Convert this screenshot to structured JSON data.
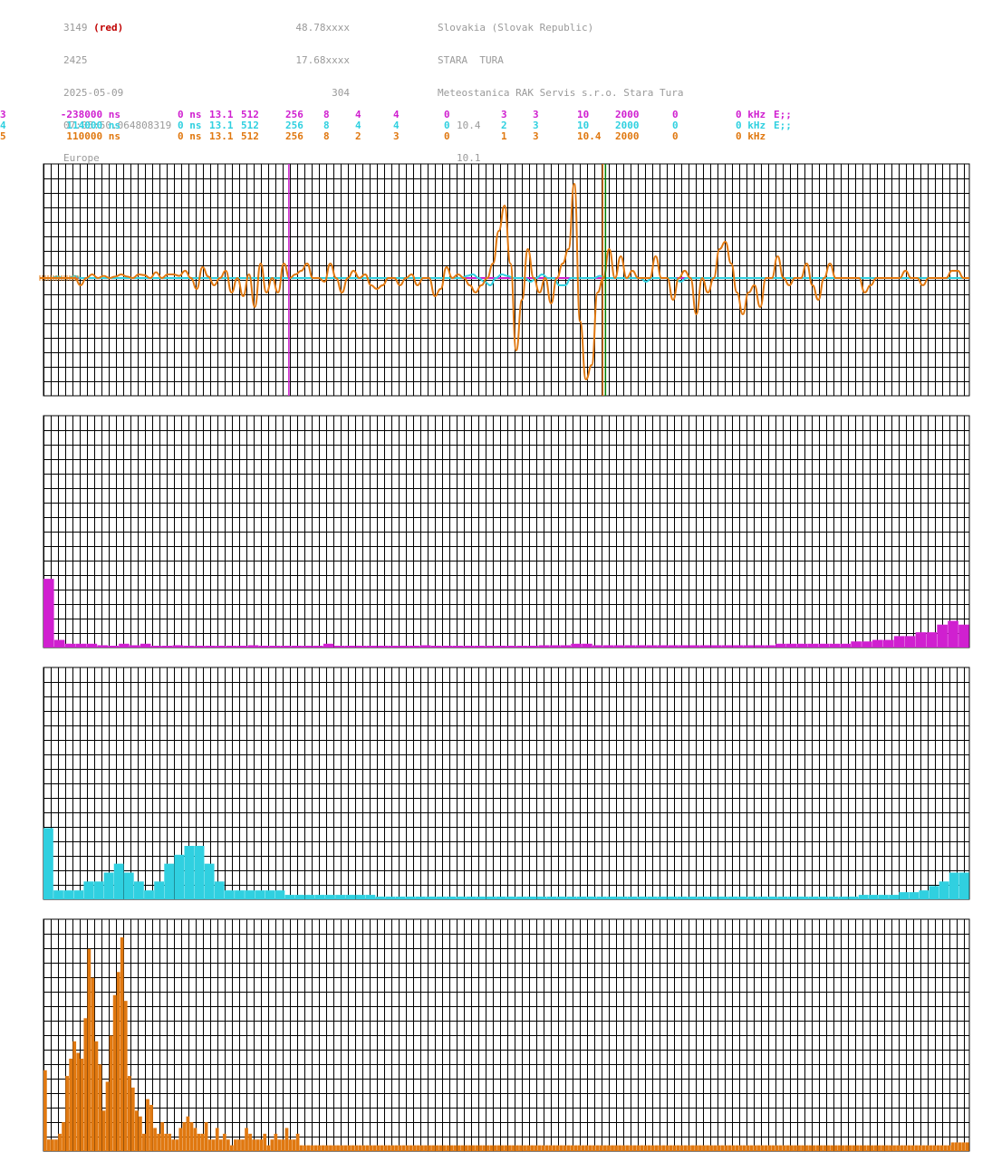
{
  "header": {
    "col1": [
      "3149",
      "2425",
      "2025-05-09",
      "07:05:50.064808319",
      "Europe"
    ],
    "col1_red": "(red)",
    "col2": [
      "48.78xxxx",
      "17.68xxxx",
      "304"
    ],
    "col3": [
      "Slovakia (Slovak Republic)",
      "STARA  TURA",
      "Meteostanica RAK Servis s.r.o. Stara Tura",
      "10.4",
      "10.1"
    ]
  },
  "channels": [
    {
      "id": "3",
      "color": "#d020d0",
      "cols": [
        "-238000 ns",
        "0 ns",
        "13.1",
        "512",
        "256",
        "8",
        "4",
        "4",
        "0",
        "3",
        "3",
        "10",
        "2000",
        "0",
        "0 kHz",
        "E;;"
      ]
    },
    {
      "id": "4",
      "color": "#30d0e0",
      "cols": [
        "114000 ns",
        "0 ns",
        "13.1",
        "512",
        "256",
        "8",
        "4",
        "4",
        "0",
        "2",
        "3",
        "10",
        "2000",
        "0",
        "0 kHz",
        "E;;"
      ]
    },
    {
      "id": "5",
      "color": "#e07810",
      "cols": [
        "110000 ns",
        "0 ns",
        "13.1",
        "512",
        "256",
        "8",
        "2",
        "3",
        "0",
        "1",
        "3",
        "10.4",
        "2000",
        "0",
        "0 kHz",
        ""
      ]
    }
  ],
  "colors": {
    "grid": "#000000",
    "magenta": "#d020d0",
    "cyan": "#30d0e0",
    "orange": "#e07810",
    "green": "#008000"
  },
  "chart_data": [
    {
      "type": "line",
      "series": [
        {
          "color": "#e07810",
          "values": [
            0,
            0,
            0,
            0,
            0,
            0,
            0,
            -1,
            0,
            0.5,
            0,
            0.3,
            0,
            0.2,
            0.5,
            0.2,
            0,
            0.5,
            0.4,
            0,
            0.8,
            0,
            0.5,
            0.5,
            0.3,
            1,
            0,
            -1.5,
            1.5,
            0.2,
            -1,
            0,
            1,
            -2,
            0,
            -2.5,
            0.5,
            -4,
            2,
            -2,
            0,
            -2,
            2,
            0,
            0.5,
            1,
            2,
            0,
            0,
            -0.5,
            2,
            0,
            -2,
            0,
            1,
            0,
            0.5,
            -1,
            -1.5,
            -1,
            0,
            0,
            -1,
            0,
            0.5,
            -1,
            0,
            0,
            -2.5,
            -1.5,
            1.5,
            0,
            0.5,
            0,
            -1,
            -2,
            -1,
            0,
            2,
            6.5,
            10,
            2,
            -10,
            -3,
            4,
            0,
            -2,
            0,
            -3.5,
            0,
            2,
            4,
            13,
            -6,
            -14,
            -12,
            -2,
            0,
            4,
            0,
            3,
            0,
            1,
            0,
            0,
            0,
            3,
            0,
            0,
            -3,
            0,
            1,
            0,
            -5,
            0,
            -2,
            0,
            4,
            5,
            2,
            -2,
            -5,
            -2,
            -1,
            -4,
            0,
            0,
            3,
            0,
            -1,
            0,
            0,
            2,
            -1,
            -3,
            0,
            2,
            0,
            0,
            0,
            0,
            0,
            -2,
            -1,
            0,
            0,
            0,
            0,
            0,
            1,
            0,
            0,
            -1,
            0,
            0,
            0,
            0,
            1,
            1,
            0,
            0
          ]
        },
        {
          "color": "#30d0e0",
          "values": [
            0,
            0,
            0,
            0.2,
            0,
            0,
            0.3,
            0,
            0,
            0,
            0,
            0,
            0,
            0,
            0,
            0,
            0,
            0,
            0,
            0,
            0,
            0,
            0,
            0,
            0,
            0,
            0,
            0,
            0,
            0,
            0,
            0,
            0,
            0,
            0,
            0,
            0,
            0,
            0,
            0,
            0,
            0,
            0,
            0,
            0,
            0,
            0,
            0,
            0,
            0,
            0,
            0,
            0,
            0,
            0,
            0,
            0,
            0,
            0,
            0,
            0,
            0,
            0,
            0,
            0,
            0,
            0,
            0,
            0,
            0,
            0,
            0,
            0,
            0,
            0.3,
            0.5,
            0,
            -0.5,
            -1,
            0,
            0.5,
            0.3,
            0,
            0,
            0,
            -0.5,
            0,
            0.5,
            0,
            0,
            -1,
            -1,
            0,
            0,
            0,
            0,
            0,
            0.3,
            0,
            0,
            0,
            0,
            0,
            0,
            0,
            -0.5,
            0,
            0,
            0,
            0,
            0,
            -0.5,
            0,
            0,
            0,
            0,
            0,
            0,
            0,
            0,
            0,
            0,
            0,
            0,
            0,
            0,
            0,
            0,
            0,
            0,
            0,
            0,
            0,
            0,
            0,
            0,
            0,
            0,
            0,
            0,
            0,
            0,
            0,
            0,
            0,
            0,
            0,
            0,
            0,
            0,
            0,
            0,
            0,
            0,
            0,
            0,
            0,
            0,
            0,
            0,
            0,
            0
          ]
        },
        {
          "color": "#d020d0",
          "values": [
            0,
            0,
            0,
            0,
            0,
            0,
            0,
            0,
            0,
            0,
            0,
            0,
            0,
            0,
            0,
            0,
            0,
            0,
            0,
            0,
            0,
            0,
            0,
            0,
            0,
            0,
            0,
            0,
            0,
            0,
            0,
            0,
            0,
            0,
            0,
            0,
            0,
            0,
            0,
            0,
            0,
            0,
            0,
            0,
            0,
            0,
            0,
            0,
            0,
            0,
            0,
            0,
            0,
            0,
            0,
            0,
            0,
            0,
            0,
            0,
            0,
            0,
            0,
            0,
            0,
            0,
            0,
            0,
            0,
            0,
            0,
            0,
            0,
            0,
            0,
            0,
            0,
            0,
            0,
            0,
            0,
            0,
            0,
            0,
            0,
            0,
            0,
            0,
            0,
            0,
            0,
            0,
            0,
            0,
            0,
            0,
            0,
            0,
            0,
            0,
            0,
            0,
            0,
            0,
            0,
            0,
            0,
            0,
            0,
            0,
            0,
            0,
            0,
            0,
            0,
            0,
            0,
            0,
            0,
            0,
            0,
            0,
            0,
            0,
            0,
            0,
            0,
            0,
            0,
            0,
            0,
            0,
            0,
            0,
            0,
            0,
            0,
            0,
            0,
            0,
            0,
            0,
            0,
            0,
            0,
            0,
            0,
            0,
            0,
            0,
            0,
            0,
            0,
            0,
            0,
            0,
            0,
            0,
            0,
            0,
            0,
            0
          ]
        }
      ],
      "markers": [
        {
          "color": "#d020d0",
          "x": 0.265
        },
        {
          "color": "#008000",
          "x": 0.607
        },
        {
          "color": "#e07810",
          "x": 0.604
        }
      ],
      "grid": true
    },
    {
      "type": "bar",
      "color": "#d020d0",
      "values": [
        9,
        1,
        0.5,
        0.5,
        0.5,
        0.3,
        0,
        0.5,
        0.3,
        0.5,
        0.2,
        0.2,
        0.3,
        0.2,
        0.2,
        0,
        0,
        0.2,
        0.2,
        0.3,
        0.2,
        0.2,
        0.2,
        0.2,
        0.2,
        0.2,
        0.5,
        0.2,
        0.2,
        0.2,
        0.2,
        0.2,
        0.2,
        0.2,
        0,
        0.3,
        0.2,
        0.2,
        0.2,
        0.2,
        0.2,
        0.2,
        0.2,
        0.2,
        0.2,
        0.2,
        0.3,
        0.3,
        0.3,
        0.5,
        0.5,
        0.3,
        0.3,
        0.3,
        0.3,
        0.3,
        0.3,
        0.3,
        0.3,
        0.3,
        0.3,
        0.3,
        0.3,
        0.3,
        0.3,
        0.3,
        0.3,
        0.3,
        0.5,
        0.5,
        0.5,
        0.5,
        0.5,
        0.5,
        0.5,
        0.8,
        0.8,
        1,
        1,
        1.5,
        1.5,
        2,
        2,
        3,
        3.5,
        3
      ]
    },
    {
      "type": "bar",
      "color": "#30d0e0",
      "values": [
        8,
        1,
        1,
        1,
        2,
        2,
        3,
        4,
        3,
        2,
        1,
        2,
        4,
        5,
        6,
        6,
        4,
        2,
        1,
        1,
        1,
        1,
        1,
        1,
        0.5,
        0.5,
        0.5,
        0.5,
        0.5,
        0.5,
        0.5,
        0.5,
        0.5,
        0.3,
        0.3,
        0.3,
        0.3,
        0.3,
        0.3,
        0.3,
        0.3,
        0.3,
        0.3,
        0.3,
        0.3,
        0.3,
        0.3,
        0.3,
        0.3,
        0.3,
        0.3,
        0.3,
        0.3,
        0.3,
        0.3,
        0.3,
        0.3,
        0.3,
        0.3,
        0.3,
        0.3,
        0.3,
        0.3,
        0.3,
        0.3,
        0.3,
        0.3,
        0.3,
        0.3,
        0.3,
        0.3,
        0.3,
        0.3,
        0.3,
        0.3,
        0.3,
        0.3,
        0.3,
        0.3,
        0.3,
        0.3,
        0.5,
        0.5,
        0.5,
        0.5,
        0.8,
        0.8,
        1,
        1.5,
        2,
        3,
        3
      ]
    },
    {
      "type": "bar",
      "color": "#e07810",
      "values": [
        14,
        2,
        2,
        2,
        3,
        5,
        13,
        16,
        19,
        17,
        16,
        23,
        35,
        30,
        19,
        15,
        7,
        12,
        20,
        27,
        31,
        37,
        26,
        13,
        11,
        7,
        6,
        3,
        9,
        8,
        4,
        3,
        5,
        3,
        3,
        2,
        2,
        4,
        5,
        6,
        5,
        4,
        3,
        3,
        5,
        2,
        2,
        4,
        2,
        3,
        2,
        1,
        2,
        2,
        2,
        4,
        3,
        2,
        2,
        2,
        3,
        1,
        2,
        3,
        2,
        2,
        4,
        2,
        2,
        3,
        1,
        1,
        1,
        1,
        1,
        1,
        1,
        1,
        1,
        1,
        1,
        1,
        1,
        1,
        1,
        1,
        1,
        1,
        1,
        1,
        1,
        1,
        1,
        1,
        1,
        1,
        1,
        1,
        1,
        1,
        1,
        1,
        1,
        1,
        1,
        1,
        1,
        1,
        1,
        1,
        1,
        1,
        1,
        1,
        1,
        1,
        1,
        1,
        1,
        1,
        1,
        1,
        1,
        1,
        1,
        1,
        1,
        1,
        1,
        1,
        1,
        1,
        1,
        1,
        1,
        1,
        1,
        1,
        1,
        1,
        1,
        1,
        1,
        1,
        1,
        1,
        1,
        1,
        1,
        1,
        1,
        1,
        1,
        1,
        1,
        1,
        1,
        1,
        1,
        1,
        1,
        1,
        1,
        1,
        1,
        1,
        1,
        1,
        1,
        1,
        1,
        1,
        1,
        1,
        1,
        1,
        1,
        1,
        1,
        1,
        1,
        1,
        1,
        1,
        1,
        1,
        1,
        1,
        1,
        1,
        1,
        1,
        1,
        1,
        1,
        1,
        1,
        1,
        1,
        1,
        1,
        1,
        1,
        1,
        1,
        1,
        1,
        1,
        1,
        1,
        1,
        1,
        1,
        1,
        1,
        1,
        1,
        1,
        1,
        1,
        1,
        1,
        1,
        1,
        1,
        1,
        1,
        1,
        1,
        1,
        1,
        1,
        1,
        1,
        1,
        1,
        1,
        1,
        1,
        1,
        1,
        1,
        1,
        1,
        1,
        1,
        1,
        1,
        1.5,
        1.5,
        1.5,
        1.5,
        1.5
      ]
    }
  ]
}
